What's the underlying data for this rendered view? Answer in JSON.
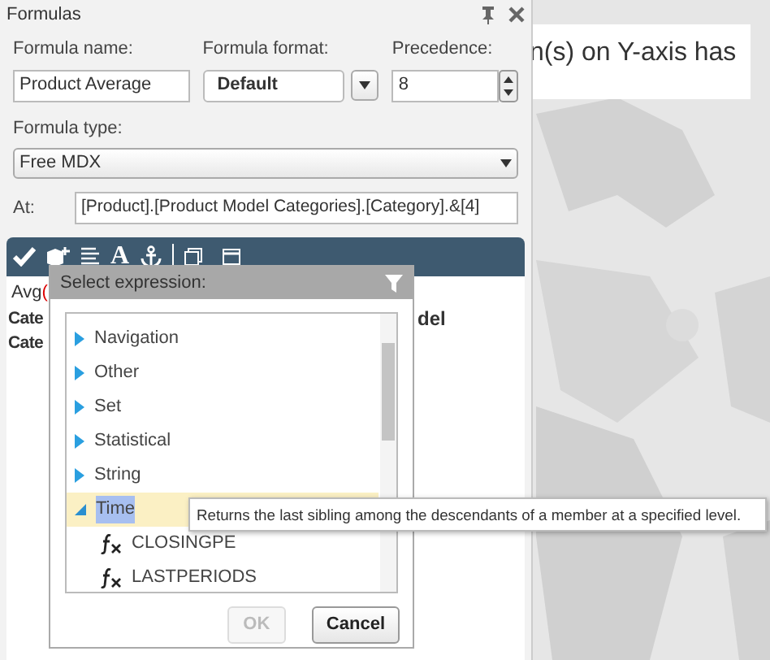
{
  "panel": {
    "title": "Formulas"
  },
  "fields": {
    "name_label": "Formula name:",
    "name_value": "Product Average",
    "format_label": "Formula format:",
    "format_value": "Default",
    "precedence_label": "Precedence:",
    "precedence_value": "8",
    "type_label": "Formula type:",
    "type_value": "Free MDX",
    "at_label": "At:",
    "at_value": "[Product].[Product Model Categories].[Category].&[4]"
  },
  "toolbar": {
    "text_tool": "A"
  },
  "editor": {
    "function": "Avg",
    "bracket": "(",
    "lines": [
      "Cate",
      "Cate"
    ],
    "right_fragment": "del"
  },
  "popup": {
    "title": "Select expression:",
    "items": [
      {
        "label": "Navigation",
        "expanded": false,
        "selected": false
      },
      {
        "label": "Other",
        "expanded": false,
        "selected": false
      },
      {
        "label": "Set",
        "expanded": false,
        "selected": false
      },
      {
        "label": "Statistical",
        "expanded": false,
        "selected": false
      },
      {
        "label": "String",
        "expanded": false,
        "selected": false
      },
      {
        "label": "Time",
        "expanded": true,
        "selected": true,
        "children": [
          {
            "label": "CLOSINGPE"
          },
          {
            "label": "LASTPERIODS"
          }
        ]
      }
    ],
    "buttons": [
      {
        "label": "OK",
        "disabled": true
      },
      {
        "label": "Cancel",
        "disabled": false
      }
    ]
  },
  "tooltip": "Returns the last sibling among the descendants of a member at a specified level.",
  "callout": "n(s) on Y-axis has"
}
